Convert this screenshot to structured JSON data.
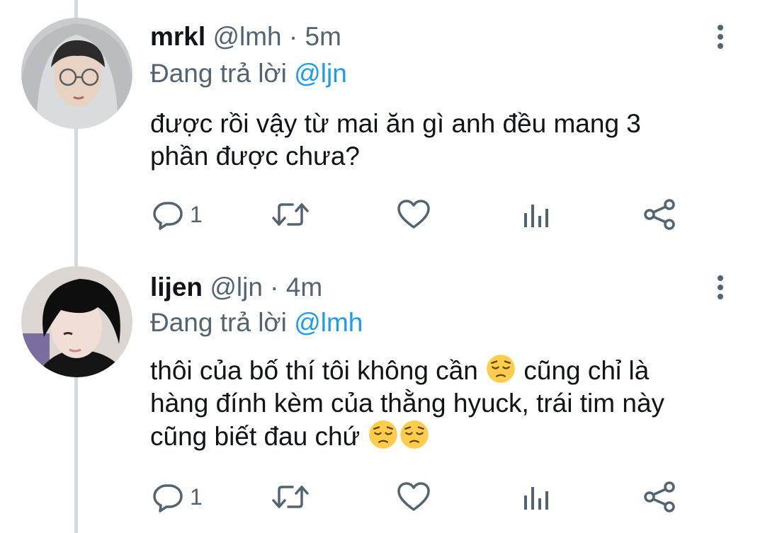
{
  "tweets": [
    {
      "display_name": "mrkl",
      "handle": "@lmh",
      "sep": "·",
      "time": "5m",
      "reply_prefix": "Đang trả lời",
      "reply_to": "@ljn",
      "lines": [
        {
          "text": "được rồi vậy từ mai ăn gì anh đều mang 3"
        },
        {
          "text": "phần được chưa?"
        }
      ],
      "reply_count": "1",
      "emoji": []
    },
    {
      "display_name": "lijen",
      "handle": "@ljn",
      "sep": "·",
      "time": "4m",
      "reply_prefix": "Đang trả lời",
      "reply_to": "@lmh",
      "lines": [
        {
          "a": "thôi của bố thí tôi không cần",
          "b": "cũng chỉ là"
        },
        {
          "text": "hàng đính kèm của thằng hyuck, trái tim này"
        },
        {
          "a": "cũng biết đau chứ"
        }
      ],
      "reply_count": "1",
      "emoji": [
        "pensive-face",
        "pensive-face",
        "pensive-face"
      ]
    }
  ],
  "icons": [
    "reply-icon",
    "retweet-icon",
    "like-icon",
    "views-icon",
    "share-icon",
    "more-icon"
  ],
  "colors": {
    "text": "#0f1419",
    "secondary": "#536471",
    "mention": "#1d9bf0",
    "thread_line": "#cfd9de",
    "emoji": "#ffcc4d"
  }
}
